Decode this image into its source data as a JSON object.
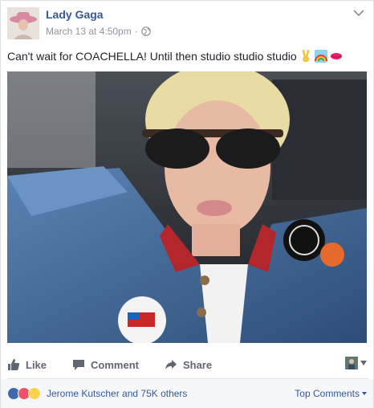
{
  "post": {
    "author": "Lady Gaga",
    "timestamp": "March 13 at 4:50pm",
    "separator": "·",
    "privacy_icon": "globe-icon",
    "menu_icon": "chevron-down-icon",
    "text": "Can't wait for COACHELLA! Until then studio studio studio",
    "emojis": [
      "victory-hand-emoji",
      "rainbow-emoji",
      "kiss-mark-emoji"
    ],
    "photo_alt": "selfie photo"
  },
  "actions": {
    "like": "Like",
    "comment": "Comment",
    "share": "Share"
  },
  "reactions": {
    "icons": [
      "like-reaction",
      "love-reaction",
      "wow-reaction"
    ],
    "summary": "Jerome Kutscher and 75K others",
    "sort_label": "Top Comments"
  },
  "colors": {
    "link": "#365899",
    "muted": "#90949c",
    "action_text": "#616770",
    "like_blue": "#4267b2",
    "love_red": "#f25268",
    "wow_yellow": "#fcd34d"
  }
}
